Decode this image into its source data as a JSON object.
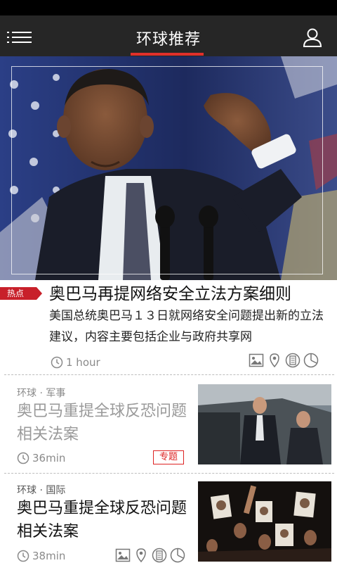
{
  "app": {
    "title": "环球推荐",
    "accent_color": "#e0302a",
    "nav_background": "#262626"
  },
  "nav": {
    "menu_icon": "hamburger-menu-icon",
    "user_icon": "user-profile-icon"
  },
  "featured": {
    "badge": "热点",
    "headline": "奥巴马再提网络安全立法方案细则",
    "summary": "美国总统奥巴马１３日就网络安全问题提出新的立法建议，内容主要包括企业与政府共享网",
    "time": "1 hour",
    "image": "photo of speaker at podium with flag backdrop",
    "actions": [
      "image-icon",
      "location-pin-icon",
      "document-icon",
      "pie-chart-icon"
    ]
  },
  "articles": [
    {
      "category": "环球 · 军事",
      "title": "奥巴马重提全球反恐问题相关法案",
      "time": "36min",
      "tag": "专题",
      "image": "photo of men in suits beside a car",
      "read": true
    },
    {
      "category": "环球 · 国际",
      "title": "奥巴马重提全球反恐问题相关法案",
      "time": "38min",
      "image": "photo of protest crowd holding portraits",
      "read": false,
      "actions": [
        "image-icon",
        "location-pin-icon",
        "document-icon",
        "pie-chart-icon"
      ]
    }
  ]
}
